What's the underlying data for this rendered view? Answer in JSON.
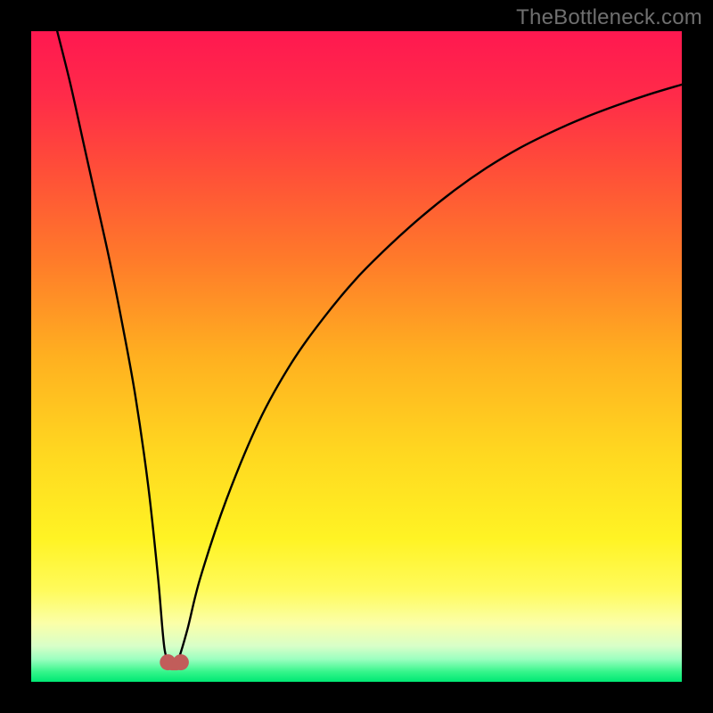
{
  "watermark": {
    "text": "TheBottleneck.com"
  },
  "colors": {
    "black": "#000000",
    "curve": "#000000",
    "marker_fill": "#c15d5a",
    "marker_stroke": "#c15d5a",
    "gradient_stops": [
      {
        "offset": 0.0,
        "color": "#ff1850"
      },
      {
        "offset": 0.1,
        "color": "#ff2b49"
      },
      {
        "offset": 0.2,
        "color": "#ff4a3a"
      },
      {
        "offset": 0.35,
        "color": "#ff7a2a"
      },
      {
        "offset": 0.5,
        "color": "#ffb020"
      },
      {
        "offset": 0.65,
        "color": "#ffd820"
      },
      {
        "offset": 0.78,
        "color": "#fff324"
      },
      {
        "offset": 0.86,
        "color": "#fffb5c"
      },
      {
        "offset": 0.91,
        "color": "#fbffa8"
      },
      {
        "offset": 0.945,
        "color": "#d8ffc8"
      },
      {
        "offset": 0.965,
        "color": "#9cffc0"
      },
      {
        "offset": 0.985,
        "color": "#34f58a"
      },
      {
        "offset": 1.0,
        "color": "#00e874"
      }
    ]
  },
  "chart_data": {
    "type": "line",
    "title": "",
    "xlabel": "",
    "ylabel": "",
    "xlim": [
      0,
      100
    ],
    "ylim": [
      0,
      100
    ],
    "grid": false,
    "legend": false,
    "series": [
      {
        "name": "bottleneck-curve",
        "x": [
          4,
          6,
          8,
          10,
          12,
          14,
          16,
          18,
          19.5,
          20.5,
          21.5,
          22,
          22.5,
          24,
          26,
          30,
          35,
          40,
          45,
          50,
          55,
          60,
          65,
          70,
          75,
          80,
          85,
          90,
          95,
          100
        ],
        "y": [
          100,
          92,
          83,
          74,
          65,
          55,
          44,
          30,
          16,
          5,
          3,
          2.2,
          3,
          8,
          16,
          28,
          40,
          49,
          56,
          62,
          67,
          71.5,
          75.5,
          79,
          82,
          84.5,
          86.7,
          88.6,
          90.3,
          91.8
        ]
      }
    ],
    "markers": [
      {
        "name": "optimal-left",
        "x": 21.0,
        "y": 3.0
      },
      {
        "name": "optimal-right",
        "x": 23.0,
        "y": 3.0
      }
    ],
    "dip_x": 22.0
  }
}
